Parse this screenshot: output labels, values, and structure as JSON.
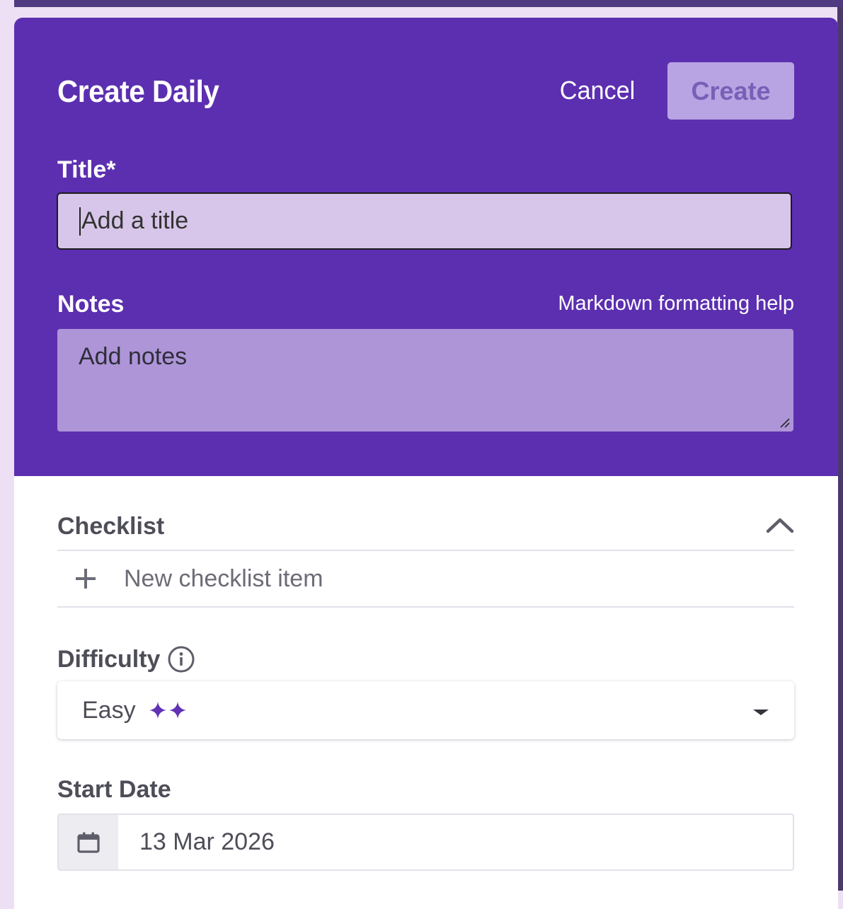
{
  "dialog": {
    "title": "Create Daily",
    "cancel_label": "Cancel",
    "create_label": "Create"
  },
  "title_field": {
    "label": "Title*",
    "placeholder": "Add a title",
    "value": ""
  },
  "notes_field": {
    "label": "Notes",
    "help_link": "Markdown formatting help",
    "placeholder": "Add notes",
    "value": ""
  },
  "checklist": {
    "label": "Checklist",
    "new_item_placeholder": "New checklist item",
    "expanded": true
  },
  "difficulty": {
    "label": "Difficulty",
    "selected": "Easy",
    "stars": 2
  },
  "start_date": {
    "label": "Start Date",
    "value": "13 Mar 2026"
  },
  "colors": {
    "header_bg": "#5c2fb0",
    "title_input_bg": "#d7c6ea",
    "notes_input_bg": "#ae95d8",
    "create_button_bg": "#b8a4e2",
    "sparkle": "#6133b4"
  },
  "icons": {
    "collapse": "chevron-up-icon",
    "add_item": "plus-icon",
    "difficulty_info": "info-icon",
    "difficulty_stars": "sparkle-icon",
    "dropdown": "caret-down-icon",
    "date": "calendar-icon"
  }
}
